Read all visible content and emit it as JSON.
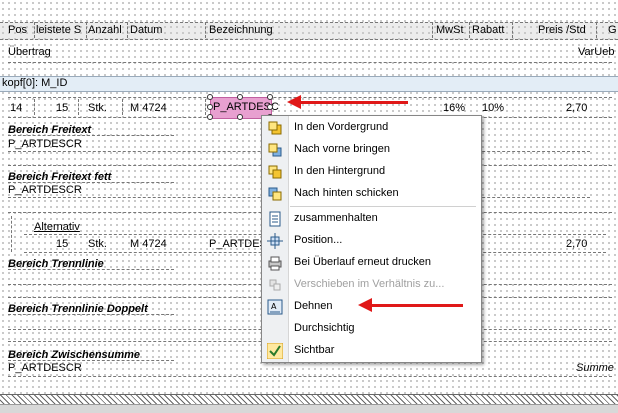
{
  "header": {
    "cols": [
      "Pos",
      "leistete S",
      "Anzahl",
      "Datum",
      "Bezeichnung",
      "MwSt",
      "Rabatt",
      "Preis /Std",
      "G"
    ]
  },
  "uebertrag": {
    "left": "Übertrag",
    "right": "VarUeb"
  },
  "kopf": {
    "label": "kopf[0]: M_ID"
  },
  "row1": {
    "pos": "14",
    "leist": "15",
    "einheit": "Stk.",
    "datum": "M 4724",
    "bez": "P_ARTDESC",
    "mwst": "16%",
    "rabatt": "10%",
    "preis": "2,70"
  },
  "sections": {
    "freitext": {
      "title": "Bereich Freitext",
      "field": "P_ARTDESCR"
    },
    "freitext_fett": {
      "title": "Bereich Freitext fett",
      "field": "P_ARTDESCR"
    },
    "alternativ": {
      "title": "Alternativ",
      "leist": "15",
      "einheit": "Stk.",
      "datum": "M 4724",
      "bez": "P_ARTDESC",
      "preis": "2,70"
    },
    "trennlinie": {
      "title": "Bereich Trennlinie"
    },
    "trennlinie_doppelt": {
      "title": "Bereich Trennlinie Doppelt"
    },
    "zwischensumme": {
      "title": "Bereich Zwischensumme",
      "field": "P_ARTDESCR",
      "summe": "Summe"
    }
  },
  "menu": {
    "items": [
      {
        "label": "In den Vordergrund",
        "icon": "bring-to-front-icon",
        "disabled": false
      },
      {
        "label": "Nach vorne bringen",
        "icon": "bring-forward-icon",
        "disabled": false
      },
      {
        "label": "In den Hintergrund",
        "icon": "send-to-back-icon",
        "disabled": false
      },
      {
        "label": "Nach hinten schicken",
        "icon": "send-backward-icon",
        "disabled": false
      },
      {
        "label": "zusammenhalten",
        "icon": "keep-together-icon",
        "disabled": false
      },
      {
        "label": "Position...",
        "icon": "position-icon",
        "disabled": false
      },
      {
        "label": "Bei Überlauf erneut drucken",
        "icon": "reprint-overflow-icon",
        "disabled": false
      },
      {
        "label": "Verschieben im Verhältnis zu...",
        "icon": "move-relative-icon",
        "disabled": true
      },
      {
        "label": "Dehnen",
        "icon": "stretch-icon",
        "disabled": false
      },
      {
        "label": "Durchsichtig",
        "icon": "",
        "disabled": false
      },
      {
        "label": "Sichtbar",
        "icon": "checkmark-icon",
        "disabled": false
      }
    ]
  },
  "colors": {
    "arrow": "#e01818",
    "selection": "#e8a0d0",
    "kopf_band": "#e3edf6"
  }
}
